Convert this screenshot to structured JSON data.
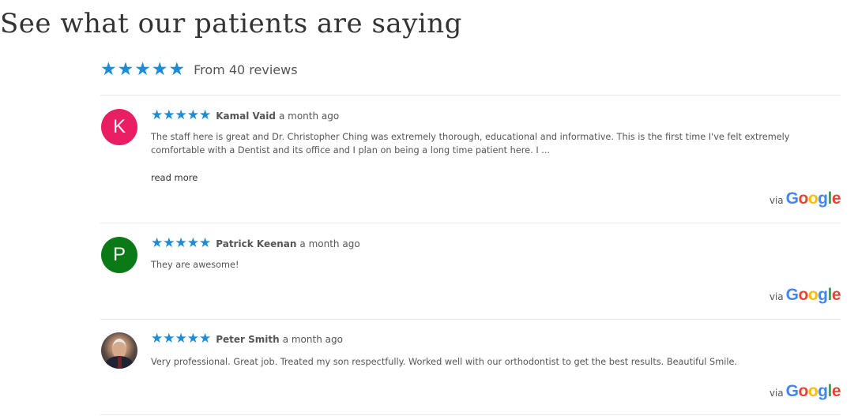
{
  "heading": "See what our patients are saying",
  "summary": {
    "rating": 5,
    "text": "From 40 reviews"
  },
  "colors": {
    "star": "#1d8bd6",
    "google_blue": "#4285f4",
    "google_red": "#ea4335",
    "google_yellow": "#fbbc05",
    "google_green": "#34a853"
  },
  "reviews": [
    {
      "author": "Kamal Vaid",
      "date": "a month ago",
      "rating": 5,
      "avatar_letter": "K",
      "text": "The staff here is great and Dr. Christopher Ching was extremely thorough, educational and informative. This is the first time I've felt extremely comfortable with a Dentist and its office and I plan on being a long time patient here. I ...",
      "read_more": "read more",
      "via": "via",
      "source": "Google"
    },
    {
      "author": "Patrick Keenan",
      "date": "a month ago",
      "rating": 5,
      "avatar_letter": "P",
      "text": "They are awesome!",
      "via": "via",
      "source": "Google"
    },
    {
      "author": "Peter Smith",
      "date": "a month ago",
      "rating": 5,
      "text": "Very professional. Great job. Treated my son respectfully. Worked well with our orthodontist to get the best results. Beautiful Smile.",
      "via": "via",
      "source": "Google"
    }
  ]
}
